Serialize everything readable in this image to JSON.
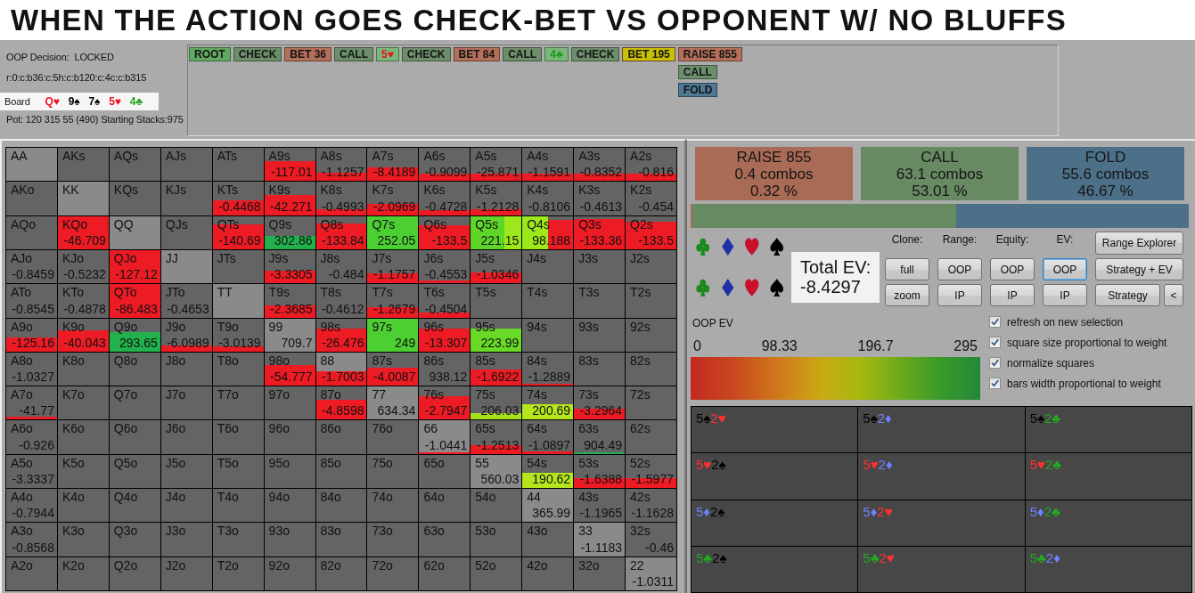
{
  "banner": {
    "title": "WHEN THE ACTION GOES CHECK-BET VS OPPONENT W/ NO BLUFFS"
  },
  "info": {
    "decision": "OOP Decision:  LOCKED",
    "line": "r:0:c:b36:c:5h:c:b120:c:4c:c:b315",
    "board_label": "Board",
    "board": [
      {
        "text": "Q♥",
        "color": "#f0101c"
      },
      {
        "text": "9♠",
        "color": "#000000"
      },
      {
        "text": "7♠",
        "color": "#000000"
      },
      {
        "text": "5♥",
        "color": "#f0101c"
      },
      {
        "text": "4♣",
        "color": "#20a020"
      }
    ],
    "pot": "Pot: 120 315 55 (490) Starting Stacks:975"
  },
  "action_tree": {
    "line": [
      {
        "label": "ROOT",
        "kind": "root",
        "selected": false
      },
      {
        "label": "CHECK",
        "kind": "check",
        "selected": false
      },
      {
        "label": "BET 36",
        "kind": "bet",
        "selected": false
      },
      {
        "label": "CALL",
        "kind": "call",
        "selected": false
      },
      {
        "label": "5♥",
        "kind": "heart",
        "selected": false
      },
      {
        "label": "CHECK",
        "kind": "check",
        "selected": false
      },
      {
        "label": "BET 84",
        "kind": "bet",
        "selected": false
      },
      {
        "label": "CALL",
        "kind": "call",
        "selected": false
      },
      {
        "label": "4♣",
        "kind": "club",
        "selected": false
      },
      {
        "label": "CHECK",
        "kind": "check",
        "selected": false
      },
      {
        "label": "BET 195",
        "kind": "bet",
        "selected": true
      }
    ],
    "options": [
      {
        "label": "RAISE 855",
        "kind": "raise",
        "selected": false
      },
      {
        "label": "CALL",
        "kind": "call",
        "selected": false
      },
      {
        "label": "FOLD",
        "kind": "fold",
        "selected": false
      }
    ]
  },
  "grid": {
    "rows": [
      {
        "cells": [
          {
            "label": "AA",
            "kind": "pair"
          },
          {
            "label": "AKs",
            "kind": "suited"
          },
          {
            "label": "AQs",
            "kind": "suited"
          },
          {
            "label": "AJs",
            "kind": "suited"
          },
          {
            "label": "ATs",
            "kind": "suited"
          },
          {
            "label": "A9s",
            "kind": "suited",
            "value": "-117.01",
            "bars": [
              {
                "color": "#ed1c24"
              }
            ]
          },
          {
            "label": "A8s",
            "kind": "suited",
            "value": "-1.1257",
            "bars": [
              {
                "color": "#ed1c24"
              }
            ]
          },
          {
            "label": "A7s",
            "kind": "suited",
            "value": "-8.4189",
            "bars": [
              {
                "color": "#ed1c24"
              }
            ]
          },
          {
            "label": "A6s",
            "kind": "suited",
            "value": "-0.9099",
            "bars": [
              {
                "color": "#ed1c24"
              }
            ]
          },
          {
            "label": "A5s",
            "kind": "suited",
            "value": "-25.871",
            "bars": [
              {
                "color": "#ed1c24"
              }
            ]
          },
          {
            "label": "A4s",
            "kind": "suited",
            "value": "-1.1591",
            "bars": [
              {
                "color": "#ed1c24"
              }
            ]
          },
          {
            "label": "A3s",
            "kind": "suited",
            "value": "-0.8352",
            "bars": [
              {
                "color": "#ed1c24"
              }
            ]
          },
          {
            "label": "A2s",
            "kind": "suited",
            "value": "-0.816",
            "bars": [
              {
                "color": "#ed1c24"
              }
            ]
          }
        ]
      },
      {
        "cells": [
          {
            "label": "AKo",
            "kind": "offsuit"
          },
          {
            "label": "KK",
            "kind": "pair"
          },
          {
            "label": "KQs",
            "kind": "suited"
          },
          {
            "label": "KJs",
            "kind": "suited"
          },
          {
            "label": "KTs",
            "kind": "suited",
            "value": "-0.4468",
            "bars": [
              {
                "color": "#ed1c24"
              }
            ]
          },
          {
            "label": "K9s",
            "kind": "suited",
            "value": "-42.271",
            "bars": [
              {
                "color": "#ed1c24"
              }
            ]
          },
          {
            "label": "K8s",
            "kind": "suited",
            "value": "-0.4993",
            "bars": [
              {
                "color": "#ed1c24"
              }
            ]
          },
          {
            "label": "K7s",
            "kind": "suited",
            "value": "-2.0969",
            "bars": [
              {
                "color": "#ed1c24"
              }
            ]
          },
          {
            "label": "K6s",
            "kind": "suited",
            "value": "-0.4728",
            "bars": [
              {
                "color": "#ed1c24"
              }
            ]
          },
          {
            "label": "K5s",
            "kind": "suited",
            "value": "-1.2128",
            "bars": [
              {
                "color": "#ed1c24"
              }
            ]
          },
          {
            "label": "K4s",
            "kind": "suited",
            "value": "-0.8106"
          },
          {
            "label": "K3s",
            "kind": "suited",
            "value": "-0.4613"
          },
          {
            "label": "K2s",
            "kind": "suited",
            "value": "-0.454"
          }
        ]
      },
      {
        "cells": [
          {
            "label": "AQo",
            "kind": "offsuit"
          },
          {
            "label": "KQo",
            "kind": "offsuit",
            "value": "-46.709",
            "bars": [
              {
                "color": "#ed1c24"
              }
            ]
          },
          {
            "label": "QQ",
            "kind": "pair"
          },
          {
            "label": "QJs",
            "kind": "suited"
          },
          {
            "label": "QTs",
            "kind": "suited",
            "value": "-140.69",
            "bars": [
              {
                "color": "#ed1c24"
              }
            ]
          },
          {
            "label": "Q9s",
            "kind": "suited",
            "value": "302.86",
            "bars": [
              {
                "color": "#22b14c"
              }
            ]
          },
          {
            "label": "Q8s",
            "kind": "suited",
            "value": "-133.84",
            "bars": [
              {
                "color": "#ed1c24"
              }
            ]
          },
          {
            "label": "Q7s",
            "kind": "suited",
            "value": "252.05",
            "bars": [
              {
                "color": "#4ccf32"
              }
            ]
          },
          {
            "label": "Q6s",
            "kind": "suited",
            "value": "-133.5",
            "bars": [
              {
                "color": "#ed1c24"
              }
            ]
          },
          {
            "label": "Q5s",
            "kind": "suited",
            "value": "221.15",
            "bars": [
              {
                "color": "#5fd52a"
              },
              {
                "color": "#9de81a"
              }
            ]
          },
          {
            "label": "Q4s",
            "kind": "suited",
            "value": "98.188",
            "bars": [
              {
                "color": "#9de81a"
              },
              {
                "color": "#ed1c24"
              }
            ]
          },
          {
            "label": "Q3s",
            "kind": "suited",
            "value": "-133.36",
            "bars": [
              {
                "color": "#ed1c24"
              }
            ]
          },
          {
            "label": "Q2s",
            "kind": "suited",
            "value": "-133.5",
            "bars": [
              {
                "color": "#ed1c24"
              }
            ]
          }
        ]
      },
      {
        "cells": [
          {
            "label": "AJo",
            "kind": "offsuit",
            "value": "-0.8459"
          },
          {
            "label": "KJo",
            "kind": "offsuit",
            "value": "-0.5232"
          },
          {
            "label": "QJo",
            "kind": "offsuit",
            "value": "-127.12",
            "bars": [
              {
                "color": "#ed1c24"
              }
            ]
          },
          {
            "label": "JJ",
            "kind": "pair"
          },
          {
            "label": "JTs",
            "kind": "suited"
          },
          {
            "label": "J9s",
            "kind": "suited",
            "value": "-3.3305",
            "bars": [
              {
                "color": "#ed1c24"
              }
            ]
          },
          {
            "label": "J8s",
            "kind": "suited",
            "value": "-0.484"
          },
          {
            "label": "J7s",
            "kind": "suited",
            "value": "-1.1757",
            "bars": [
              {
                "color": "#ed1c24"
              }
            ]
          },
          {
            "label": "J6s",
            "kind": "suited",
            "value": "-0.4553",
            "bars": [
              {
                "color": "#ed1c24"
              }
            ]
          },
          {
            "label": "J5s",
            "kind": "suited",
            "value": "-1.0346",
            "bars": [
              {
                "color": "#ed1c24"
              }
            ]
          },
          {
            "label": "J4s",
            "kind": "suited"
          },
          {
            "label": "J3s",
            "kind": "suited"
          },
          {
            "label": "J2s",
            "kind": "suited"
          }
        ]
      },
      {
        "cells": [
          {
            "label": "ATo",
            "kind": "offsuit",
            "value": "-0.8545"
          },
          {
            "label": "KTo",
            "kind": "offsuit",
            "value": "-0.4878"
          },
          {
            "label": "QTo",
            "kind": "offsuit",
            "value": "-86.483",
            "bars": [
              {
                "color": "#ed1c24"
              }
            ]
          },
          {
            "label": "JTo",
            "kind": "offsuit",
            "value": "-0.4653"
          },
          {
            "label": "TT",
            "kind": "pair"
          },
          {
            "label": "T9s",
            "kind": "suited",
            "value": "-2.3685",
            "bars": [
              {
                "color": "#ed1c24"
              }
            ]
          },
          {
            "label": "T8s",
            "kind": "suited",
            "value": "-0.4612"
          },
          {
            "label": "T7s",
            "kind": "suited",
            "value": "-1.2679",
            "bars": [
              {
                "color": "#ed1c24"
              }
            ]
          },
          {
            "label": "T6s",
            "kind": "suited",
            "value": "-0.4504",
            "bars": [
              {
                "color": "#ed1c24"
              }
            ]
          },
          {
            "label": "T5s",
            "kind": "suited"
          },
          {
            "label": "T4s",
            "kind": "suited"
          },
          {
            "label": "T3s",
            "kind": "suited"
          },
          {
            "label": "T2s",
            "kind": "suited"
          }
        ]
      },
      {
        "cells": [
          {
            "label": "A9o",
            "kind": "offsuit",
            "value": "-125.16",
            "bars": [
              {
                "color": "#ed1c24"
              }
            ]
          },
          {
            "label": "K9o",
            "kind": "offsuit",
            "value": "-40.043",
            "bars": [
              {
                "color": "#ed1c24"
              }
            ]
          },
          {
            "label": "Q9o",
            "kind": "offsuit",
            "value": "293.65",
            "bars": [
              {
                "color": "#22b14c"
              }
            ]
          },
          {
            "label": "J9o",
            "kind": "offsuit",
            "value": "-6.0989",
            "bars": [
              {
                "color": "#ed1c24"
              }
            ]
          },
          {
            "label": "T9o",
            "kind": "offsuit",
            "value": "-3.0139",
            "bars": [
              {
                "color": "#ed1c24"
              }
            ]
          },
          {
            "label": "99",
            "kind": "pair",
            "value": "709.7"
          },
          {
            "label": "98s",
            "kind": "suited",
            "value": "-26.476",
            "bars": [
              {
                "color": "#ed1c24"
              }
            ]
          },
          {
            "label": "97s",
            "kind": "suited",
            "value": "249",
            "bars": [
              {
                "color": "#4ccf32"
              }
            ]
          },
          {
            "label": "96s",
            "kind": "suited",
            "value": "-13.307",
            "bars": [
              {
                "color": "#ed1c24"
              }
            ]
          },
          {
            "label": "95s",
            "kind": "suited",
            "value": "223.99",
            "bars": [
              {
                "color": "#68d926"
              }
            ]
          },
          {
            "label": "94s",
            "kind": "suited"
          },
          {
            "label": "93s",
            "kind": "suited"
          },
          {
            "label": "92s",
            "kind": "suited"
          }
        ]
      },
      {
        "cells": [
          {
            "label": "A8o",
            "kind": "offsuit",
            "value": "-1.0327"
          },
          {
            "label": "K8o",
            "kind": "offsuit"
          },
          {
            "label": "Q8o",
            "kind": "offsuit"
          },
          {
            "label": "J8o",
            "kind": "offsuit"
          },
          {
            "label": "T8o",
            "kind": "offsuit"
          },
          {
            "label": "98o",
            "kind": "offsuit",
            "value": "-54.777",
            "bars": [
              {
                "color": "#ed1c24"
              }
            ]
          },
          {
            "label": "88",
            "kind": "pair",
            "value": "-1.7003",
            "bars": [
              {
                "color": "#ed1c24"
              }
            ]
          },
          {
            "label": "87s",
            "kind": "suited",
            "value": "-4.0087",
            "bars": [
              {
                "color": "#ed1c24"
              }
            ]
          },
          {
            "label": "86s",
            "kind": "suited",
            "value": "938.12"
          },
          {
            "label": "85s",
            "kind": "suited",
            "value": "-1.6922",
            "bars": [
              {
                "color": "#ed1c24"
              }
            ]
          },
          {
            "label": "84s",
            "kind": "suited",
            "value": "-1.2889",
            "bars": [
              {
                "color": "#ed1c24"
              }
            ]
          },
          {
            "label": "83s",
            "kind": "suited"
          },
          {
            "label": "82s",
            "kind": "suited"
          }
        ]
      },
      {
        "cells": [
          {
            "label": "A7o",
            "kind": "offsuit",
            "value": "-41.77",
            "bars": [
              {
                "color": "#ed1c24"
              }
            ]
          },
          {
            "label": "K7o",
            "kind": "offsuit"
          },
          {
            "label": "Q7o",
            "kind": "offsuit"
          },
          {
            "label": "J7o",
            "kind": "offsuit"
          },
          {
            "label": "T7o",
            "kind": "offsuit"
          },
          {
            "label": "97o",
            "kind": "offsuit"
          },
          {
            "label": "87o",
            "kind": "offsuit",
            "value": "-4.8598",
            "bars": [
              {
                "color": "#ed1c24"
              }
            ]
          },
          {
            "label": "77",
            "kind": "pair",
            "value": "634.34"
          },
          {
            "label": "76s",
            "kind": "suited",
            "value": "-2.7947",
            "bars": [
              {
                "color": "#ed1c24"
              }
            ]
          },
          {
            "label": "75s",
            "kind": "suited",
            "value": "206.03",
            "bars": [
              {
                "color": "#a9e01c"
              }
            ]
          },
          {
            "label": "74s",
            "kind": "suited",
            "value": "200.69",
            "bars": [
              {
                "color": "#b5e61d"
              }
            ]
          },
          {
            "label": "73s",
            "kind": "suited",
            "value": "-3.2964",
            "bars": [
              {
                "color": "#ed1c24"
              }
            ]
          },
          {
            "label": "72s",
            "kind": "suited"
          }
        ]
      },
      {
        "cells": [
          {
            "label": "A6o",
            "kind": "offsuit",
            "value": "-0.926"
          },
          {
            "label": "K6o",
            "kind": "offsuit"
          },
          {
            "label": "Q6o",
            "kind": "offsuit"
          },
          {
            "label": "J6o",
            "kind": "offsuit"
          },
          {
            "label": "T6o",
            "kind": "offsuit"
          },
          {
            "label": "96o",
            "kind": "offsuit"
          },
          {
            "label": "86o",
            "kind": "offsuit"
          },
          {
            "label": "76o",
            "kind": "offsuit"
          },
          {
            "label": "66",
            "kind": "pair",
            "value": "-1.0441",
            "bars": [
              {
                "color": "#ed1c24"
              }
            ]
          },
          {
            "label": "65s",
            "kind": "suited",
            "value": "-1.2513",
            "bars": [
              {
                "color": "#ed1c24"
              }
            ]
          },
          {
            "label": "64s",
            "kind": "suited",
            "value": "-1.0897",
            "bars": [
              {
                "color": "#ed1c24"
              }
            ]
          },
          {
            "label": "63s",
            "kind": "suited",
            "value": "904.49",
            "bars": [
              {
                "color": "#22b14c"
              }
            ]
          },
          {
            "label": "62s",
            "kind": "suited"
          }
        ]
      },
      {
        "cells": [
          {
            "label": "A5o",
            "kind": "offsuit",
            "value": "-3.3337"
          },
          {
            "label": "K5o",
            "kind": "offsuit"
          },
          {
            "label": "Q5o",
            "kind": "offsuit"
          },
          {
            "label": "J5o",
            "kind": "offsuit"
          },
          {
            "label": "T5o",
            "kind": "offsuit"
          },
          {
            "label": "95o",
            "kind": "offsuit"
          },
          {
            "label": "85o",
            "kind": "offsuit"
          },
          {
            "label": "75o",
            "kind": "offsuit"
          },
          {
            "label": "65o",
            "kind": "offsuit"
          },
          {
            "label": "55",
            "kind": "pair",
            "value": "560.03"
          },
          {
            "label": "54s",
            "kind": "suited",
            "value": "190.62",
            "bars": [
              {
                "color": "#b5e61d"
              }
            ]
          },
          {
            "label": "53s",
            "kind": "suited",
            "value": "-1.6388",
            "bars": [
              {
                "color": "#ed1c24"
              }
            ]
          },
          {
            "label": "52s",
            "kind": "suited",
            "value": "-1.5977",
            "bars": [
              {
                "color": "#ed1c24"
              }
            ]
          }
        ]
      },
      {
        "cells": [
          {
            "label": "A4o",
            "kind": "offsuit",
            "value": "-0.7944"
          },
          {
            "label": "K4o",
            "kind": "offsuit"
          },
          {
            "label": "Q4o",
            "kind": "offsuit"
          },
          {
            "label": "J4o",
            "kind": "offsuit"
          },
          {
            "label": "T4o",
            "kind": "offsuit"
          },
          {
            "label": "94o",
            "kind": "offsuit"
          },
          {
            "label": "84o",
            "kind": "offsuit"
          },
          {
            "label": "74o",
            "kind": "offsuit"
          },
          {
            "label": "64o",
            "kind": "offsuit"
          },
          {
            "label": "54o",
            "kind": "offsuit"
          },
          {
            "label": "44",
            "kind": "pair",
            "value": "365.99"
          },
          {
            "label": "43s",
            "kind": "suited",
            "value": "-1.1965"
          },
          {
            "label": "42s",
            "kind": "suited",
            "value": "-1.1628"
          }
        ]
      },
      {
        "cells": [
          {
            "label": "A3o",
            "kind": "offsuit",
            "value": "-0.8568"
          },
          {
            "label": "K3o",
            "kind": "offsuit"
          },
          {
            "label": "Q3o",
            "kind": "offsuit"
          },
          {
            "label": "J3o",
            "kind": "offsuit"
          },
          {
            "label": "T3o",
            "kind": "offsuit"
          },
          {
            "label": "93o",
            "kind": "offsuit"
          },
          {
            "label": "83o",
            "kind": "offsuit"
          },
          {
            "label": "73o",
            "kind": "offsuit"
          },
          {
            "label": "63o",
            "kind": "offsuit"
          },
          {
            "label": "53o",
            "kind": "offsuit"
          },
          {
            "label": "43o",
            "kind": "offsuit"
          },
          {
            "label": "33",
            "kind": "pair",
            "value": "-1.1183"
          },
          {
            "label": "32s",
            "kind": "suited",
            "value": "-0.46"
          }
        ]
      },
      {
        "cells": [
          {
            "label": "A2o",
            "kind": "offsuit"
          },
          {
            "label": "K2o",
            "kind": "offsuit"
          },
          {
            "label": "Q2o",
            "kind": "offsuit"
          },
          {
            "label": "J2o",
            "kind": "offsuit"
          },
          {
            "label": "T2o",
            "kind": "offsuit"
          },
          {
            "label": "92o",
            "kind": "offsuit"
          },
          {
            "label": "82o",
            "kind": "offsuit"
          },
          {
            "label": "72o",
            "kind": "offsuit"
          },
          {
            "label": "62o",
            "kind": "offsuit"
          },
          {
            "label": "52o",
            "kind": "offsuit"
          },
          {
            "label": "42o",
            "kind": "offsuit"
          },
          {
            "label": "32o",
            "kind": "offsuit"
          },
          {
            "label": "22",
            "kind": "pair",
            "value": "-1.0311"
          }
        ]
      }
    ]
  },
  "strategy": {
    "actions": [
      {
        "label": "RAISE 855",
        "combos": "0.4 combos",
        "percent": "0.32 %",
        "color": "#a96a56"
      },
      {
        "label": "CALL",
        "combos": "63.1 combos",
        "percent": "53.01 %",
        "color": "#678a62"
      },
      {
        "label": "FOLD",
        "combos": "55.6 combos",
        "percent": "46.67 %",
        "color": "#4d7089"
      }
    ]
  },
  "suit_filters": [
    {
      "suits": [
        {
          "kind": "club"
        },
        {
          "kind": "diamond"
        },
        {
          "kind": "heart"
        },
        {
          "kind": "spade"
        }
      ]
    },
    {
      "suits": [
        {
          "kind": "club"
        },
        {
          "kind": "diamond"
        },
        {
          "kind": "heart"
        },
        {
          "kind": "spade"
        }
      ]
    }
  ],
  "total_ev": {
    "label": "Total EV:",
    "value": "-8.4297"
  },
  "view_controls": [
    {
      "label": "Clone:",
      "buttons": [
        {
          "label": "full",
          "selected": false
        },
        {
          "label": "zoom",
          "selected": false
        }
      ]
    },
    {
      "label": "Range:",
      "buttons": [
        {
          "label": "OOP",
          "selected": false
        },
        {
          "label": "IP",
          "selected": false
        }
      ]
    },
    {
      "label": "Equity:",
      "buttons": [
        {
          "label": "OOP",
          "selected": false
        },
        {
          "label": "IP",
          "selected": false
        }
      ]
    },
    {
      "label": "EV:",
      "buttons": [
        {
          "label": "OOP",
          "selected": true
        },
        {
          "label": "IP",
          "selected": false
        }
      ]
    }
  ],
  "side_buttons": [
    {
      "label": "Range Explorer"
    },
    {
      "label": "Strategy + EV"
    },
    {
      "label": "Strategy"
    },
    {
      "label": "<"
    }
  ],
  "ev_legend": {
    "title": "OOP EV",
    "ticks": [
      "0",
      "98.33",
      "196.7",
      "295"
    ]
  },
  "display_options": [
    {
      "label": "refresh on new selection",
      "checked": true
    },
    {
      "label": "square size proportional to weight",
      "checked": true
    },
    {
      "label": "normalize squares",
      "checked": true
    },
    {
      "label": "bars width proportional to weight",
      "checked": true
    }
  ],
  "combo_grid": {
    "rows": [
      {
        "cells": [
          {
            "cards": [
              {
                "text": "5♠",
                "color": "#000000"
              },
              {
                "text": "2♥",
                "color": "#ff3030"
              }
            ]
          },
          {
            "cards": [
              {
                "text": "5♠",
                "color": "#000000"
              },
              {
                "text": "2♦",
                "color": "#7080ff"
              }
            ]
          },
          {
            "cards": [
              {
                "text": "5♠",
                "color": "#000000"
              },
              {
                "text": "2♣",
                "color": "#22aa22"
              }
            ]
          }
        ]
      },
      {
        "cells": [
          {
            "cards": [
              {
                "text": "5♥",
                "color": "#ff3030"
              },
              {
                "text": "2♠",
                "color": "#000000"
              }
            ]
          },
          {
            "cards": [
              {
                "text": "5♥",
                "color": "#ff3030"
              },
              {
                "text": "2♦",
                "color": "#7080ff"
              }
            ]
          },
          {
            "cards": [
              {
                "text": "5♥",
                "color": "#ff3030"
              },
              {
                "text": "2♣",
                "color": "#22aa22"
              }
            ]
          }
        ]
      },
      {
        "cells": [
          {
            "cards": [
              {
                "text": "5♦",
                "color": "#7080ff"
              },
              {
                "text": "2♠",
                "color": "#000000"
              }
            ]
          },
          {
            "cards": [
              {
                "text": "5♦",
                "color": "#7080ff"
              },
              {
                "text": "2♥",
                "color": "#ff3030"
              }
            ]
          },
          {
            "cards": [
              {
                "text": "5♦",
                "color": "#7080ff"
              },
              {
                "text": "2♣",
                "color": "#22aa22"
              }
            ]
          }
        ]
      },
      {
        "cells": [
          {
            "cards": [
              {
                "text": "5♣",
                "color": "#22aa22"
              },
              {
                "text": "2♠",
                "color": "#000000"
              }
            ]
          },
          {
            "cards": [
              {
                "text": "5♣",
                "color": "#22aa22"
              },
              {
                "text": "2♥",
                "color": "#ff3030"
              }
            ]
          },
          {
            "cards": [
              {
                "text": "5♣",
                "color": "#22aa22"
              },
              {
                "text": "2♦",
                "color": "#7080ff"
              }
            ]
          }
        ]
      }
    ]
  }
}
